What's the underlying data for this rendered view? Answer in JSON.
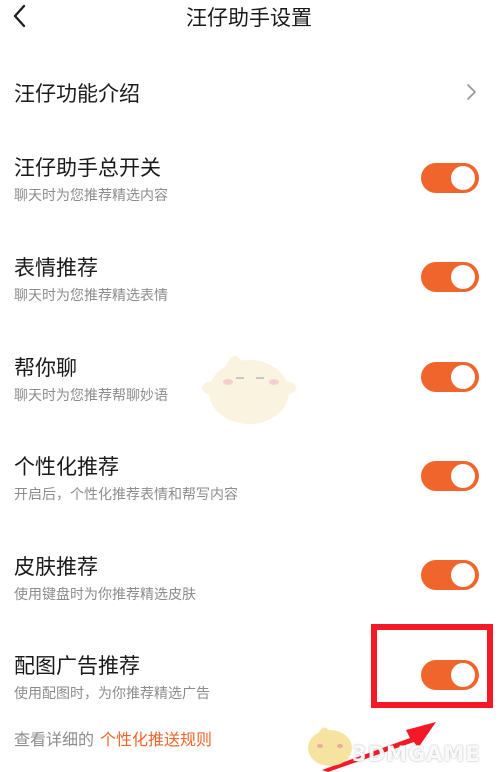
{
  "header": {
    "title": "汪仔助手设置",
    "back_icon": "chevron-left-icon"
  },
  "intro": {
    "label": "汪仔功能介绍",
    "chevron_icon": "chevron-right-icon"
  },
  "settings": [
    {
      "label": "汪仔助手总开关",
      "desc": "聊天时为您推荐精选内容",
      "enabled": true
    },
    {
      "label": "表情推荐",
      "desc": "聊天时为您推荐精选表情",
      "enabled": true
    },
    {
      "label": "帮你聊",
      "desc": "聊天时为您推荐帮聊妙语",
      "enabled": true
    },
    {
      "label": "个性化推荐",
      "desc": "开启后，个性化推荐表情和帮写内容",
      "enabled": true
    },
    {
      "label": "皮肤推荐",
      "desc": "使用键盘时为你推荐精选皮肤",
      "enabled": true
    },
    {
      "label": "配图广告推荐",
      "desc": "使用配图时，为你推荐精选广告",
      "enabled": true
    }
  ],
  "footer": {
    "prefix": "查看详细的",
    "link": "个性化推送规则"
  },
  "watermark": "3DMGAME",
  "colors": {
    "accent": "#f0652b",
    "highlight": "#f51826",
    "text_primary": "#1a1a1a",
    "text_secondary": "#8c8c8c"
  }
}
